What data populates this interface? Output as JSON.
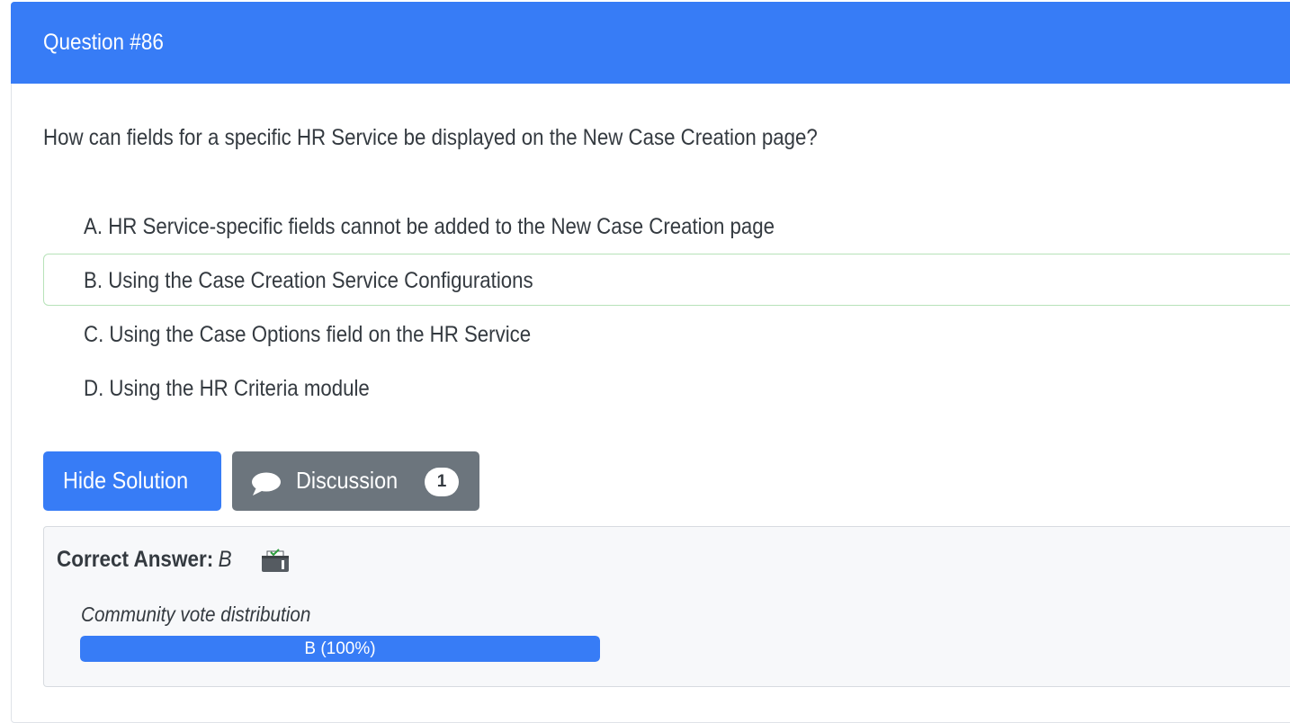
{
  "header": {
    "title": "Question #86"
  },
  "question": {
    "text": "How can fields for a specific HR Service be displayed on the New Case Creation page?"
  },
  "choices": [
    {
      "label": "A. HR Service-specific fields cannot be added to the New Case Creation page"
    },
    {
      "label": "B. Using the Case Creation Service Configurations"
    },
    {
      "label": "C. Using the Case Options field on the HR Service"
    },
    {
      "label": "D. Using the HR Criteria module"
    }
  ],
  "buttons": {
    "hide_solution": "Hide Solution",
    "discussion": "Discussion",
    "discussion_count": "1",
    "discussion_icon": "chat-icon"
  },
  "answer": {
    "label": "Correct Answer:",
    "value": "B",
    "icon": "ballot-box-icon",
    "vote_title": "Community vote distribution",
    "vote_text": "B (100%)",
    "vote_percent": 100
  },
  "colors": {
    "primary": "#377cf6",
    "secondary": "#6c757d",
    "correct_border": "#b7e2b9"
  }
}
